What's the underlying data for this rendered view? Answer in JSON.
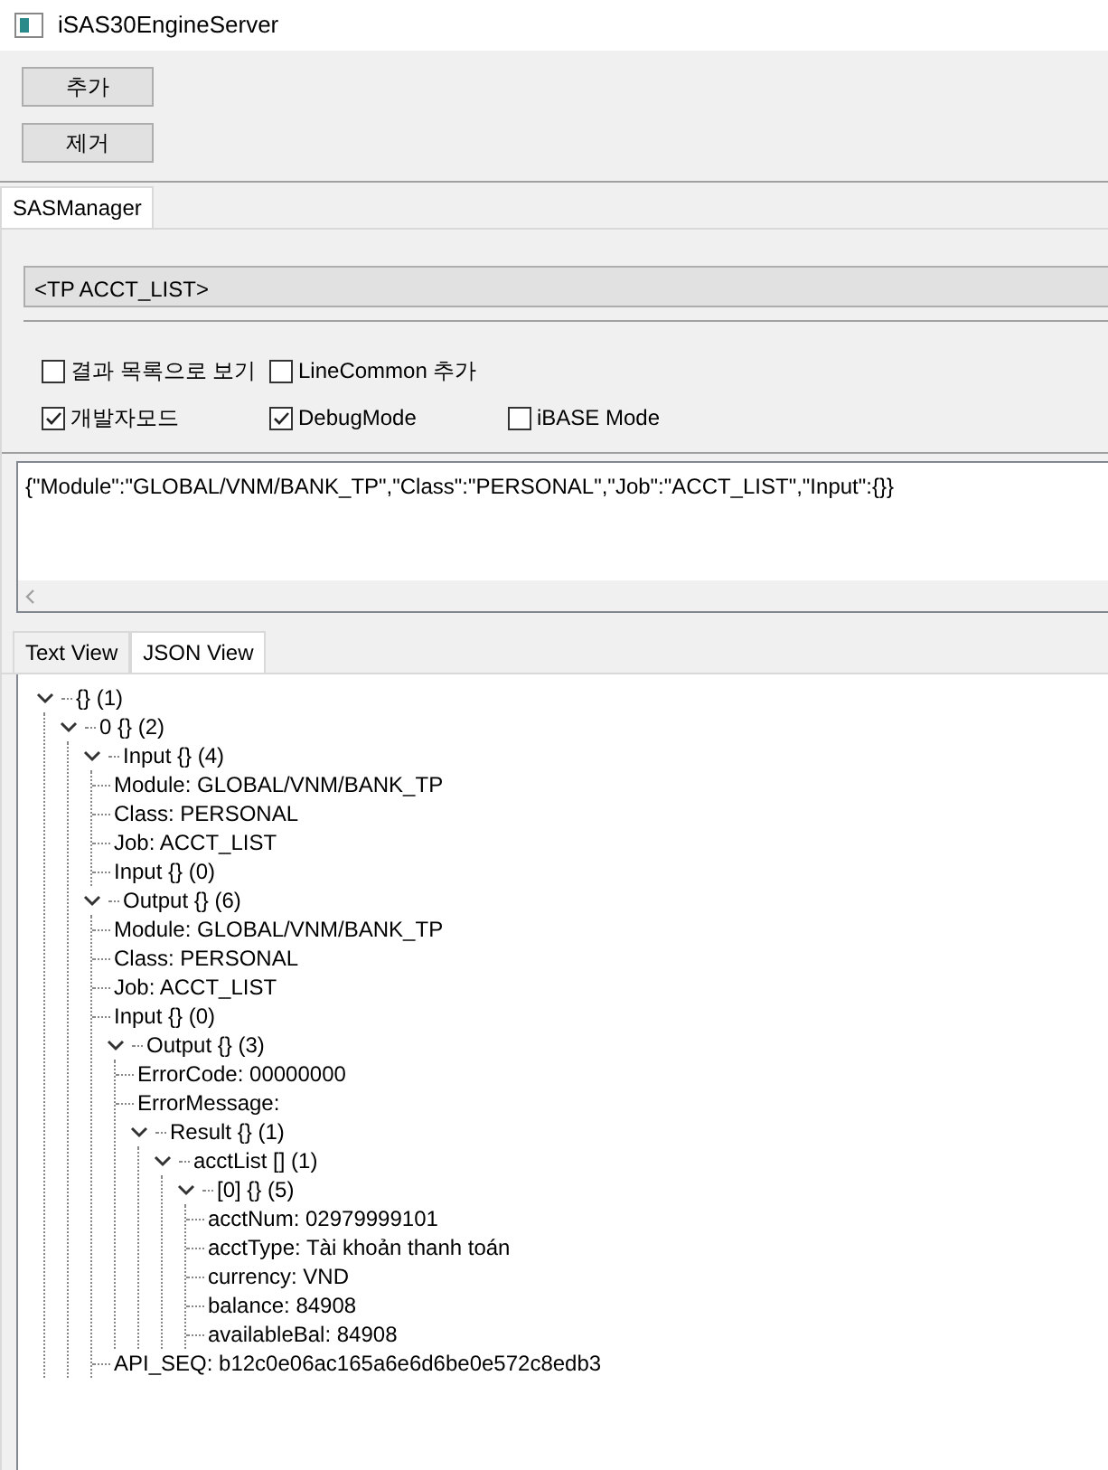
{
  "window": {
    "title": "iSAS30EngineServer"
  },
  "buttons": [
    "추가",
    "제거"
  ],
  "main_tabs": [
    {
      "label": "SASManager",
      "selected": true
    }
  ],
  "tp_selector": {
    "value": "<TP ACCT_LIST>"
  },
  "options": [
    [
      {
        "label": "결과 목록으로 보기",
        "checked": false
      },
      {
        "label": "LineCommon 추가",
        "checked": false
      }
    ],
    [
      {
        "label": "개발자모드",
        "checked": true
      },
      {
        "label": "DebugMode",
        "checked": true
      },
      {
        "label": "iBASE Mode",
        "checked": false
      }
    ]
  ],
  "request": {
    "value": "{\"Module\":\"GLOBAL/VNM/BANK_TP\",\"Class\":\"PERSONAL\",\"Job\":\"ACCT_LIST\",\"Input\":{}}"
  },
  "view_tabs": [
    {
      "label": "Text View",
      "selected": false
    },
    {
      "label": "JSON View",
      "selected": true
    }
  ],
  "tree": [
    {
      "label": "{} (1)",
      "expanded": true,
      "children": [
        {
          "label": "0 {} (2)",
          "expanded": true,
          "children": [
            {
              "label": "Input {} (4)",
              "expanded": true,
              "children": [
                {
                  "label": "Module: GLOBAL/VNM/BANK_TP"
                },
                {
                  "label": "Class: PERSONAL"
                },
                {
                  "label": "Job: ACCT_LIST"
                },
                {
                  "label": "Input {} (0)"
                }
              ]
            },
            {
              "label": "Output {} (6)",
              "expanded": true,
              "children": [
                {
                  "label": "Module: GLOBAL/VNM/BANK_TP"
                },
                {
                  "label": "Class: PERSONAL"
                },
                {
                  "label": "Job: ACCT_LIST"
                },
                {
                  "label": "Input {} (0)"
                },
                {
                  "label": "Output {} (3)",
                  "expanded": true,
                  "children": [
                    {
                      "label": "ErrorCode: 00000000"
                    },
                    {
                      "label": "ErrorMessage:"
                    },
                    {
                      "label": "Result {} (1)",
                      "expanded": true,
                      "children": [
                        {
                          "label": "acctList [] (1)",
                          "expanded": true,
                          "children": [
                            {
                              "label": "[0] {} (5)",
                              "expanded": true,
                              "children": [
                                {
                                  "label": "acctNum: 02979999101"
                                },
                                {
                                  "label": "acctType: Tài khoản thanh toán"
                                },
                                {
                                  "label": "currency: VND"
                                },
                                {
                                  "label": "balance: 84908"
                                },
                                {
                                  "label": "availableBal: 84908"
                                }
                              ]
                            }
                          ]
                        }
                      ]
                    }
                  ]
                },
                {
                  "label": "API_SEQ: b12c0e06ac165a6e6d6be0e572c8edb3"
                }
              ]
            }
          ]
        }
      ]
    }
  ]
}
